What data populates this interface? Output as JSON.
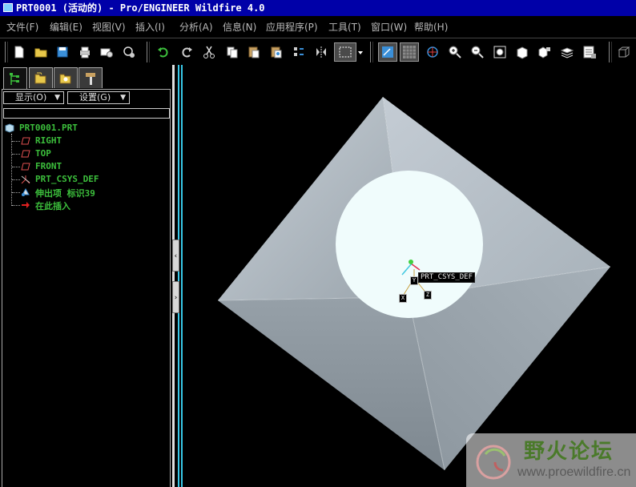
{
  "window": {
    "title": "PRT0001 (活动的) - Pro/ENGINEER Wildfire 4.0"
  },
  "menu": [
    {
      "label": "文件(F)"
    },
    {
      "label": "编辑(E)"
    },
    {
      "label": "视图(V)"
    },
    {
      "label": "插入(I)"
    },
    {
      "label": "分析(A)"
    },
    {
      "label": "信息(N)"
    },
    {
      "label": "应用程序(P)"
    },
    {
      "label": "工具(T)"
    },
    {
      "label": "窗口(W)"
    },
    {
      "label": "帮助(H)"
    }
  ],
  "panel": {
    "show_dropdown": "显示(O)",
    "settings_dropdown": "设置(G)",
    "tree": [
      {
        "label": "PRT0001.PRT"
      },
      {
        "label": "RIGHT"
      },
      {
        "label": "TOP"
      },
      {
        "label": "FRONT"
      },
      {
        "label": "PRT_CSYS_DEF"
      },
      {
        "label": "伸出项 标识39"
      },
      {
        "label": "在此插入"
      }
    ]
  },
  "viewport": {
    "csys_label": "PRT_CSYS_DEF",
    "axis_x": "X",
    "axis_y": "Y",
    "axis_z": "Z"
  },
  "watermark": {
    "name": "野火论坛",
    "url": "www.proewildfire.cn"
  },
  "colors": {
    "title_bar": "#0000a8",
    "tree_text": "#3cbf3c",
    "splitter_accent": "#38c8e8",
    "model_gray": "#a6b0b8",
    "hole_fill": "#f0fcfc"
  }
}
